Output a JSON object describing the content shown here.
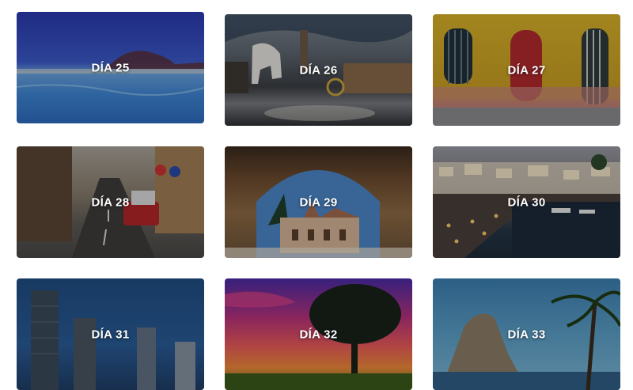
{
  "cards": [
    {
      "label": "DÍA 25"
    },
    {
      "label": "DÍA 26"
    },
    {
      "label": "DÍA 27"
    },
    {
      "label": "DÍA 28"
    },
    {
      "label": "DÍA 29"
    },
    {
      "label": "DÍA 30"
    },
    {
      "label": "DÍA 31"
    },
    {
      "label": "DÍA 32"
    },
    {
      "label": "DÍA 33"
    }
  ]
}
